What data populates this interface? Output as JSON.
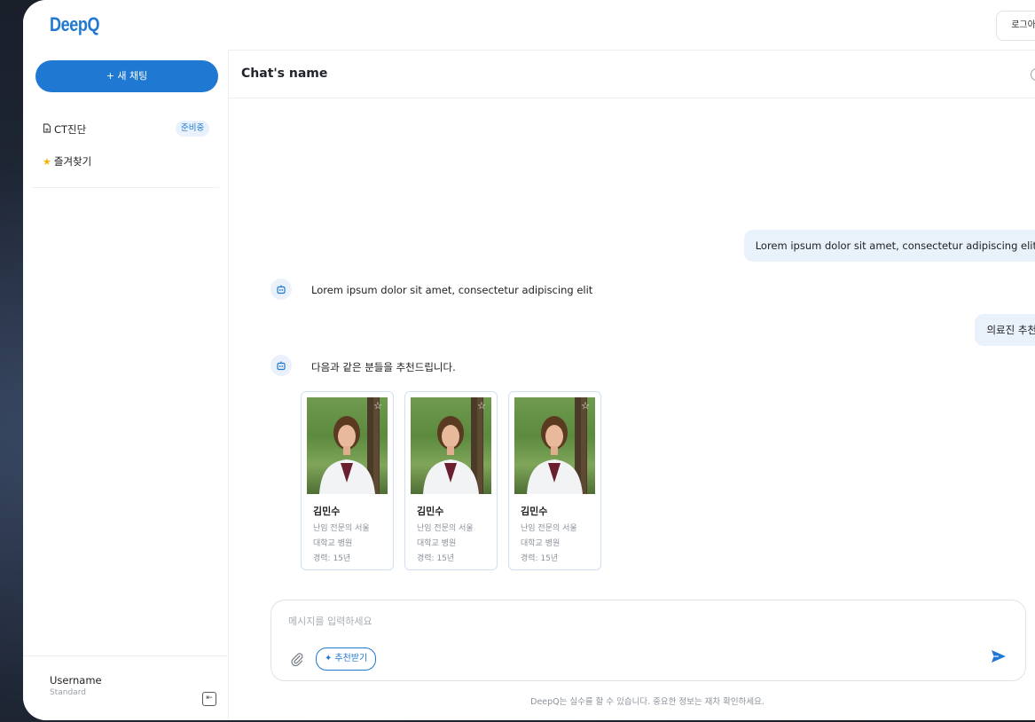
{
  "app": {
    "logo": "DeepQ",
    "logout_label": "로그아웃"
  },
  "sidebar": {
    "new_chat_label": "+ 새 채팅",
    "items": [
      {
        "icon": "document-icon",
        "label": "CT진단",
        "badge": "준비중"
      },
      {
        "icon": "star-icon",
        "label": "즐겨찾기"
      }
    ],
    "user": {
      "name": "Username",
      "plan": "Standard"
    }
  },
  "chat": {
    "title": "Chat's name",
    "messages": [
      {
        "role": "user",
        "text": "Lorem ipsum dolor sit amet, consectetur adipiscing elit"
      },
      {
        "role": "bot",
        "text": "Lorem ipsum dolor sit amet, consectetur adipiscing elit"
      },
      {
        "role": "user",
        "text": "의료진 추천"
      },
      {
        "role": "bot",
        "text": "다음과 같은 분들을 추천드립니다."
      }
    ],
    "doctors": [
      {
        "name": "김민수",
        "line1": "난임 전문의 서울",
        "line2": "대학교 병원",
        "career": "경력: 15년"
      },
      {
        "name": "김민수",
        "line1": "난임 전문의 서울",
        "line2": "대학교 병원",
        "career": "경력: 15년"
      },
      {
        "name": "김민수",
        "line1": "난임 전문의 서울",
        "line2": "대학교 병원",
        "career": "경력: 15년"
      }
    ]
  },
  "composer": {
    "placeholder": "메시지를 입력하세요",
    "recommend_label": "추천받기",
    "disclaimer": "DeepQ는 실수를 할 수 있습니다. 중요한 정보는 재차 확인하세요."
  },
  "colors": {
    "accent": "#1f78d1",
    "user_bubble": "#e9f1fb",
    "badge_bg": "#e8f1fc"
  }
}
